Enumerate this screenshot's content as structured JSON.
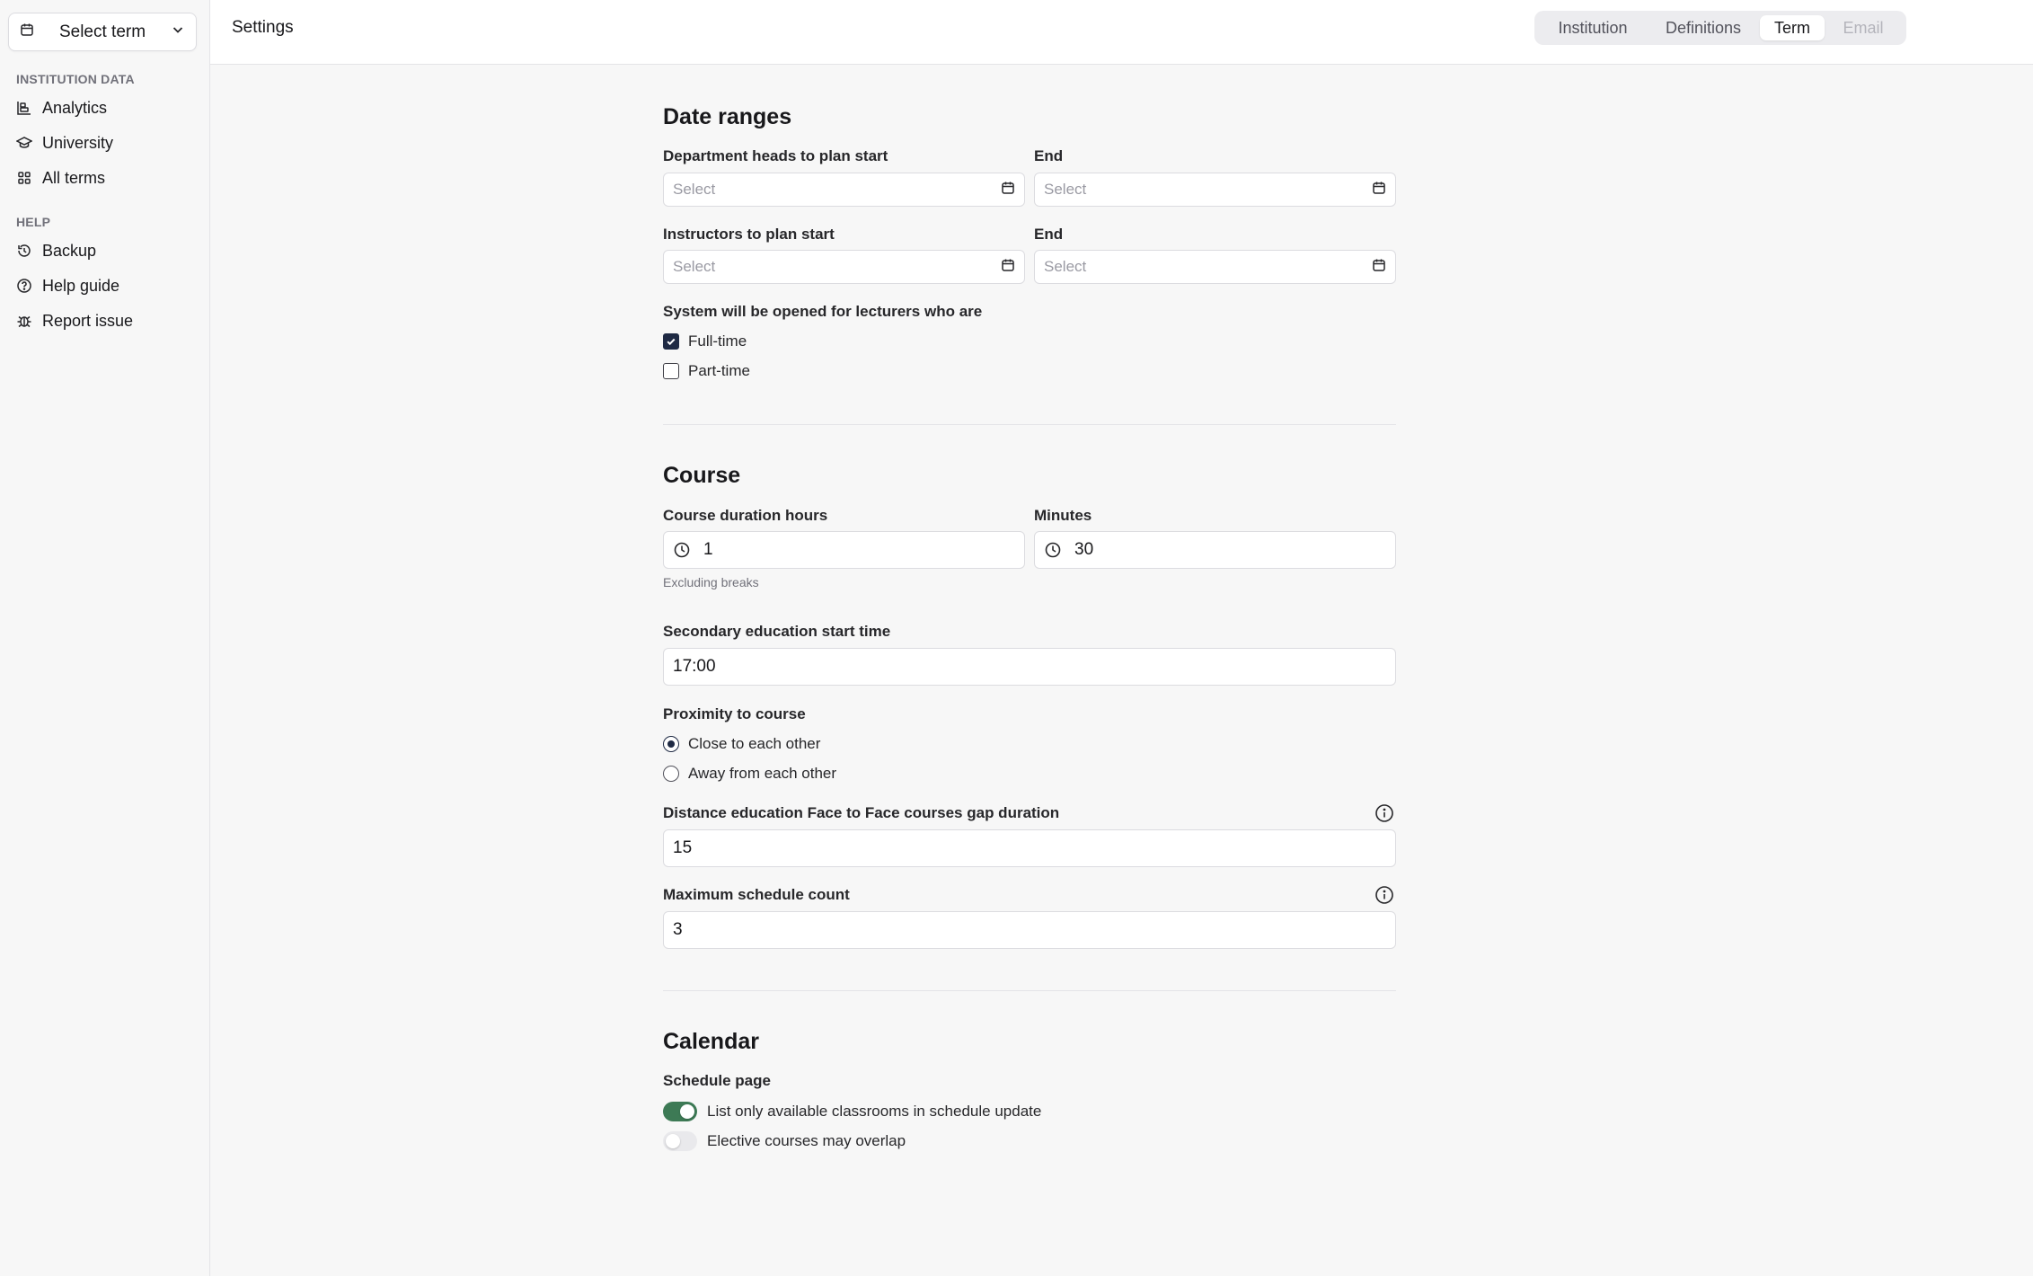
{
  "sidebar": {
    "term_select": {
      "label": "Select term",
      "icon": "calendar-icon"
    },
    "groups": [
      {
        "title": "INSTITUTION DATA",
        "items": [
          {
            "label": "Analytics",
            "icon": "chart-icon"
          },
          {
            "label": "University",
            "icon": "graduation-cap-icon"
          },
          {
            "label": "All terms",
            "icon": "grid-icon"
          }
        ]
      },
      {
        "title": "HELP",
        "items": [
          {
            "label": "Backup",
            "icon": "history-icon"
          },
          {
            "label": "Help guide",
            "icon": "help-circle-icon"
          },
          {
            "label": "Report issue",
            "icon": "bug-icon"
          }
        ]
      }
    ]
  },
  "header": {
    "title": "Settings",
    "tabs": [
      {
        "label": "Institution",
        "state": "normal"
      },
      {
        "label": "Definitions",
        "state": "normal"
      },
      {
        "label": "Term",
        "state": "active"
      },
      {
        "label": "Email",
        "state": "disabled"
      }
    ]
  },
  "date_ranges": {
    "heading": "Date ranges",
    "dept_heads_start_label": "Department heads to plan start",
    "dept_heads_end_label": "End",
    "instructors_start_label": "Instructors to plan start",
    "instructors_end_label": "End",
    "date_placeholder": "Select",
    "lecturers_label": "System will be opened for lecturers who are",
    "lecturer_types": [
      {
        "label": "Full-time",
        "checked": true
      },
      {
        "label": "Part-time",
        "checked": false
      }
    ]
  },
  "course": {
    "heading": "Course",
    "duration_hours_label": "Course duration hours",
    "duration_hours_value": "1",
    "minutes_label": "Minutes",
    "minutes_value": "30",
    "duration_hint": "Excluding breaks",
    "secondary_start_label": "Secondary education start time",
    "secondary_start_value": "17:00",
    "proximity_label": "Proximity to course",
    "proximity_options": [
      {
        "label": "Close to each other",
        "selected": true
      },
      {
        "label": "Away from each other",
        "selected": false
      }
    ],
    "gap_label": "Distance education Face to Face courses gap duration",
    "gap_value": "15",
    "max_schedule_label": "Maximum schedule count",
    "max_schedule_value": "3"
  },
  "calendar": {
    "heading": "Calendar",
    "schedule_page_label": "Schedule page",
    "toggles": [
      {
        "label": "List only available classrooms in schedule update",
        "on": true
      },
      {
        "label": "Elective courses may overlap",
        "on": false
      }
    ]
  },
  "colors": {
    "toggle_on": "#3d7a55",
    "checkbox_on": "#1f2a44",
    "background": "#f7f7f7"
  }
}
